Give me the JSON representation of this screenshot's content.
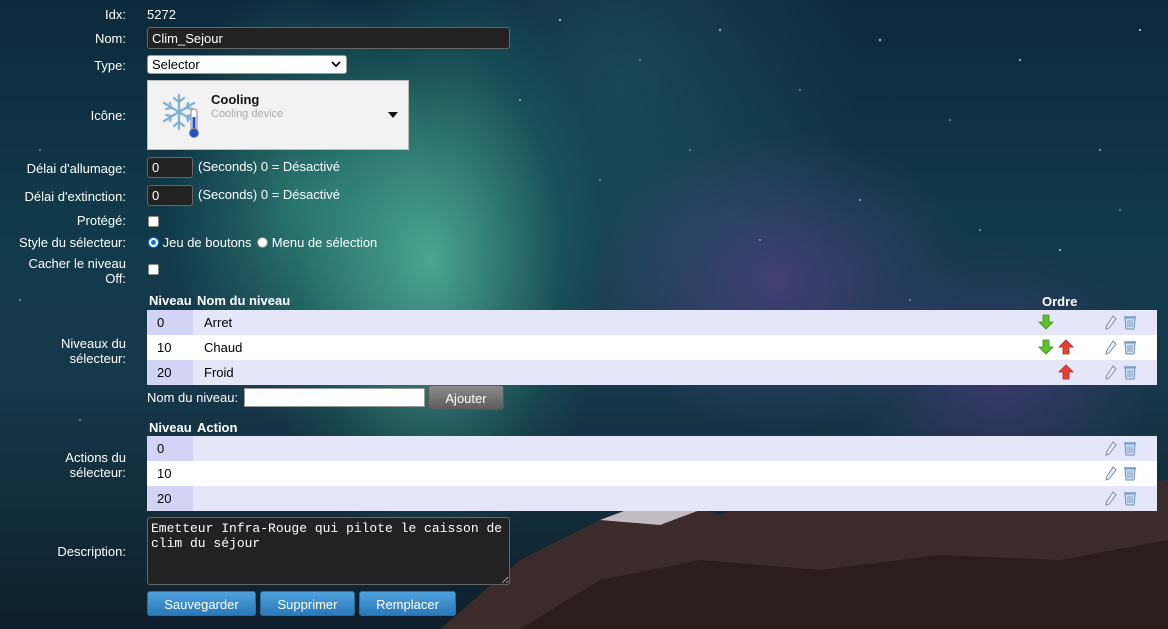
{
  "fields": {
    "idx_label": "Idx:",
    "idx_value": "5272",
    "name_label": "Nom:",
    "name_value": "Clim_Sejour",
    "type_label": "Type:",
    "type_value": "Selector",
    "icon_label": "Icône:",
    "icon_title": "Cooling",
    "icon_subtitle": "Cooling device",
    "on_delay_label": "Délai d'allumage:",
    "on_delay_value": "0",
    "on_delay_hint": "(Seconds) 0 = Désactivé",
    "off_delay_label": "Délai d'extinction:",
    "off_delay_value": "0",
    "off_delay_hint": "(Seconds) 0 = Désactivé",
    "protected_label": "Protégé:",
    "style_label": "Style du sélecteur:",
    "style_option_buttons": "Jeu de boutons",
    "style_option_menu": "Menu de sélection",
    "hide_off_label_1": "Cacher le niveau",
    "hide_off_label_2": "Off:"
  },
  "levels": {
    "section_label_1": "Niveaux du",
    "section_label_2": "sélecteur:",
    "col_level": "Niveau",
    "col_name": "Nom du niveau",
    "col_order": "Ordre",
    "rows": [
      {
        "level": "0",
        "name": "Arret"
      },
      {
        "level": "10",
        "name": "Chaud"
      },
      {
        "level": "20",
        "name": "Froid"
      }
    ],
    "add_label": "Nom du niveau:",
    "add_button": "Ajouter"
  },
  "actions": {
    "section_label_1": "Actions du",
    "section_label_2": "sélecteur:",
    "col_level": "Niveau",
    "col_action": "Action",
    "rows": [
      {
        "level": "0",
        "action": ""
      },
      {
        "level": "10",
        "action": ""
      },
      {
        "level": "20",
        "action": ""
      }
    ]
  },
  "description": {
    "label": "Description:",
    "value": "Emetteur Infra-Rouge qui pilote le caisson de clim du séjour"
  },
  "buttons": {
    "save": "Sauvegarder",
    "delete": "Supprimer",
    "replace": "Remplacer"
  },
  "colors": {
    "row_odd": "#e6e6fa",
    "row_even": "#ffffff",
    "button_blue": "#3a8cc8",
    "arrow_down": "#5cc22e",
    "arrow_up": "#e8413a"
  }
}
